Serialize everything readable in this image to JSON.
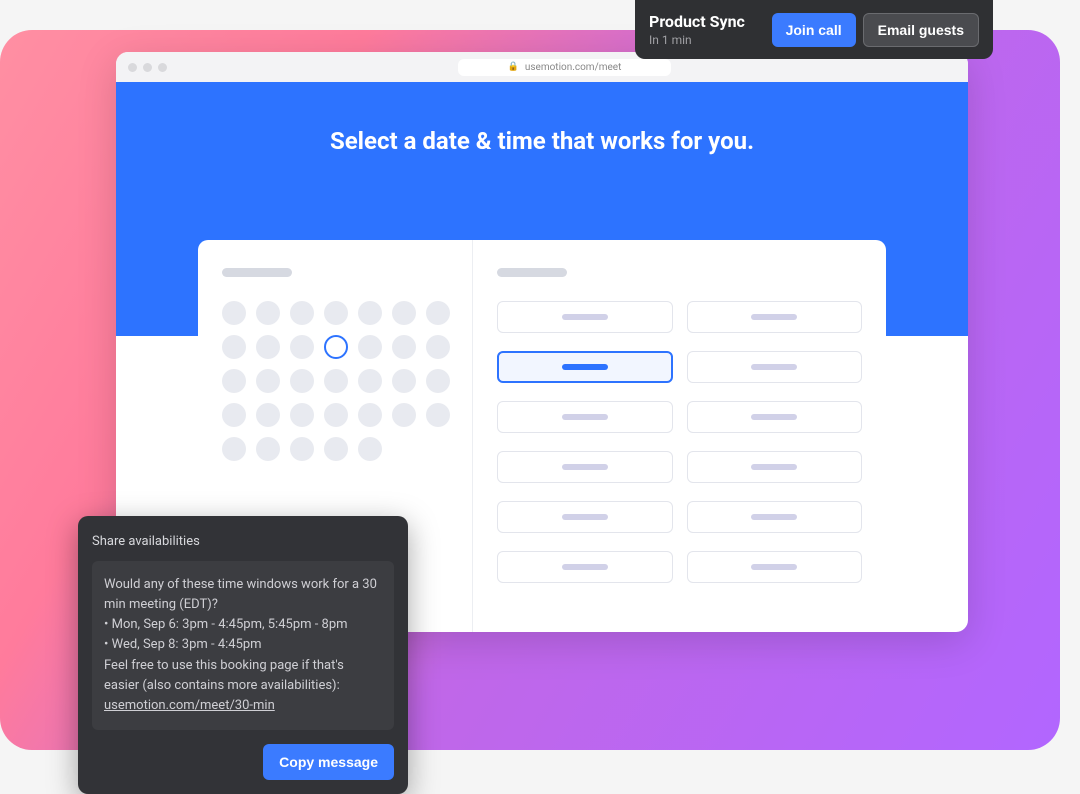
{
  "toast": {
    "title": "Product Sync",
    "subtitle": "In 1 min",
    "join_label": "Join call",
    "email_label": "Email guests"
  },
  "browser": {
    "url": "usemotion.com/meet"
  },
  "banner": {
    "title": "Select a date & time that works for you."
  },
  "calendar": {
    "selected_index": 10,
    "day_count": 33
  },
  "slots": {
    "count": 12,
    "selected_index": 2
  },
  "share": {
    "title": "Share availabilities",
    "intro": "Would any of these time windows work for a 30 min meeting (EDT)?",
    "bullet1": "• Mon, Sep 6: 3pm - 4:45pm, 5:45pm - 8pm",
    "bullet2": "• Wed, Sep 8: 3pm - 4:45pm",
    "outro": "Feel free to use this booking page if that's easier (also contains more availabilities):",
    "link": "usemotion.com/meet/30-min",
    "copy_label": "Copy message"
  }
}
